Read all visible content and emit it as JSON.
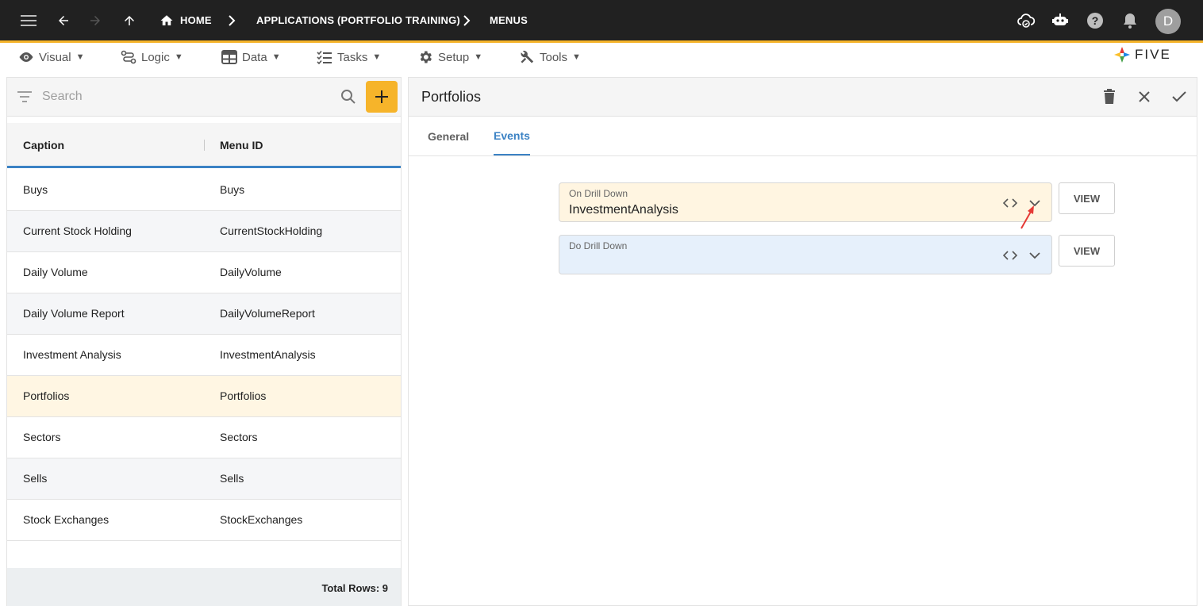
{
  "topbar": {
    "breadcrumb": {
      "home": "HOME",
      "application": "APPLICATIONS (PORTFOLIO TRAINING)",
      "current": "MENUS"
    },
    "avatar_initial": "D",
    "icons": [
      "menu-icon",
      "back-arrow-icon",
      "forward-arrow-icon",
      "up-arrow-icon",
      "home-icon",
      "cloud-sync-icon",
      "chat-bot-icon",
      "help-icon",
      "notification-bell-icon"
    ]
  },
  "menubar": {
    "items": [
      {
        "label": "Visual",
        "icon": "eye-icon"
      },
      {
        "label": "Logic",
        "icon": "logic-flow-icon"
      },
      {
        "label": "Data",
        "icon": "table-grid-icon"
      },
      {
        "label": "Tasks",
        "icon": "checklist-icon"
      },
      {
        "label": "Setup",
        "icon": "gear-icon"
      },
      {
        "label": "Tools",
        "icon": "tools-icon"
      }
    ],
    "caret": "▼",
    "logo_text": "FIVE"
  },
  "list": {
    "search_placeholder": "Search",
    "columns": [
      "Caption",
      "Menu ID"
    ],
    "rows": [
      {
        "caption": "Buys",
        "menu_id": "Buys"
      },
      {
        "caption": "Current Stock Holding",
        "menu_id": "CurrentStockHolding"
      },
      {
        "caption": "Daily Volume",
        "menu_id": "DailyVolume"
      },
      {
        "caption": "Daily Volume Report",
        "menu_id": "DailyVolumeReport"
      },
      {
        "caption": "Investment Analysis",
        "menu_id": "InvestmentAnalysis"
      },
      {
        "caption": "Portfolios",
        "menu_id": "Portfolios"
      },
      {
        "caption": "Sectors",
        "menu_id": "Sectors"
      },
      {
        "caption": "Sells",
        "menu_id": "Sells"
      },
      {
        "caption": "Stock Exchanges",
        "menu_id": "StockExchanges"
      }
    ],
    "selected_row": "Portfolios",
    "total_rows": "Total Rows: 9"
  },
  "detail": {
    "title": "Portfolios",
    "tabs": [
      "General",
      "Events"
    ],
    "active_tab": "Events",
    "fields": [
      {
        "label": "On Drill Down",
        "value": "InvestmentAnalysis",
        "button": "VIEW"
      },
      {
        "label": "Do Drill Down",
        "value": "",
        "button": "VIEW"
      }
    ]
  },
  "colors": {
    "topbar_bg": "#212121",
    "accent_yellow": "#f6b42a",
    "tab_blue": "#3b82c4",
    "selected_row": "#fff6e3",
    "field_on_bg": "#fff5e1",
    "field_do_bg": "#e6f0fb",
    "annotation_arrow": "#e53935"
  }
}
